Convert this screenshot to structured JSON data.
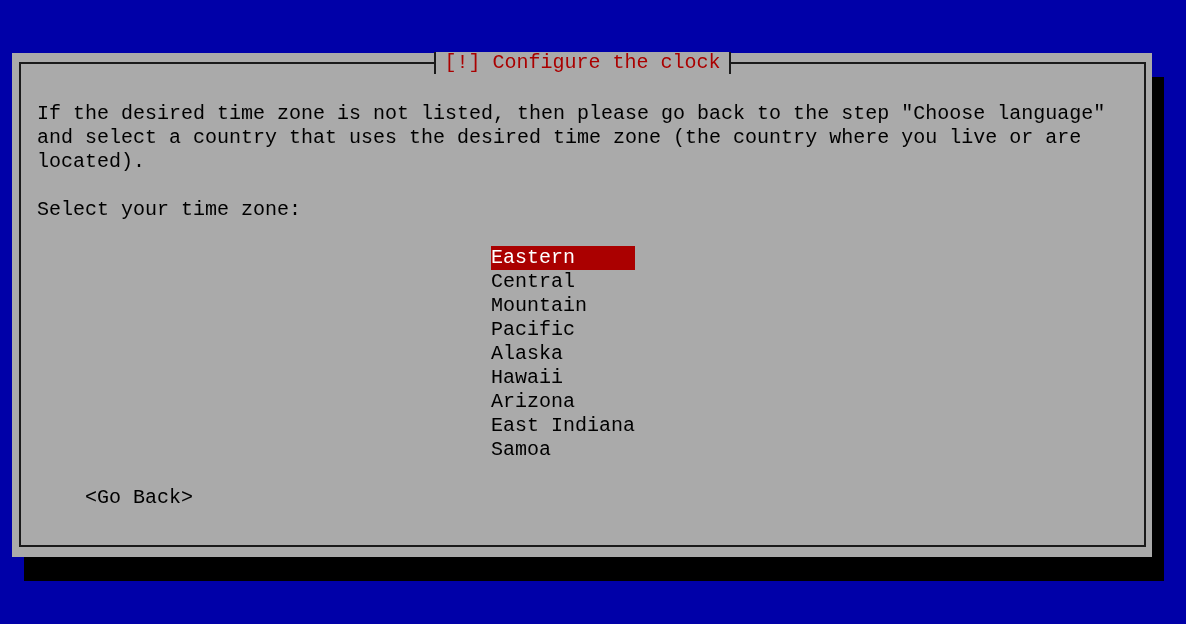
{
  "dialog": {
    "title": "[!] Configure the clock",
    "message": "If the desired time zone is not listed, then please go back to the step \"Choose language\" and select a country that uses the desired time zone (the country where you live or are located).",
    "prompt": "Select your time zone:",
    "options": [
      {
        "label": "Eastern",
        "selected": true
      },
      {
        "label": "Central",
        "selected": false
      },
      {
        "label": "Mountain",
        "selected": false
      },
      {
        "label": "Pacific",
        "selected": false
      },
      {
        "label": "Alaska",
        "selected": false
      },
      {
        "label": "Hawaii",
        "selected": false
      },
      {
        "label": "Arizona",
        "selected": false
      },
      {
        "label": "East Indiana",
        "selected": false
      },
      {
        "label": "Samoa",
        "selected": false
      }
    ],
    "buttons": [
      {
        "label": "<Go Back>"
      }
    ]
  }
}
